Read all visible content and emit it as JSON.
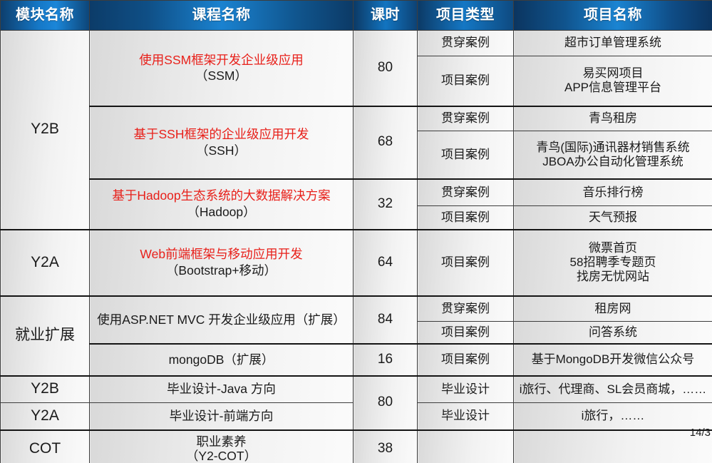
{
  "header": {
    "columns": [
      {
        "label": "模块名称",
        "key": "module"
      },
      {
        "label": "课程名称",
        "key": "course"
      },
      {
        "label": "课时",
        "key": "hours"
      },
      {
        "label": "项目类型",
        "key": "ptype"
      },
      {
        "label": "项目名称",
        "key": "pname"
      }
    ]
  },
  "colors": {
    "header_blue_dark": "#0c3a66",
    "header_blue_light": "#1a84d2",
    "course_red": "#e8201a",
    "cell_gray": "#d9d9d9",
    "cell_white": "#fbfbfb",
    "border": "#1a1a1a"
  },
  "rows": {
    "modules": {
      "y2b_1": "Y2B",
      "y2a_1": "Y2A",
      "employ": "就业扩展",
      "y2b_2": "Y2B",
      "y2a_2": "Y2A",
      "cot": "COT"
    },
    "courses": {
      "ssm_title": "使用SSM框架开发企业级应用",
      "ssm_sub": "（SSM）",
      "ssh_title": "基于SSH框架的企业级应用开发",
      "ssh_sub": "（SSH）",
      "hadoop_title": "基于Hadoop生态系统的大数据解决方案",
      "hadoop_sub": "（Hadoop）",
      "web_title": "Web前端框架与移动应用开发",
      "web_sub": "（Bootstrap+移动）",
      "aspnet": "使用ASP.NET MVC 开发企业级应用（扩展）",
      "mongodb": "mongoDB（扩展）",
      "grad_java": "毕业设计-Java 方向",
      "grad_front": "毕业设计-前端方向",
      "cot_title": "职业素养",
      "cot_sub": "（Y2-COT）"
    },
    "hours": {
      "ssm": "80",
      "ssh": "68",
      "hadoop": "32",
      "web": "64",
      "aspnet": "84",
      "mongodb": "16",
      "grad": "80",
      "cot": "38"
    },
    "ptypes": {
      "through_case": "贯穿案例",
      "project_case": "项目案例",
      "grad_design": "毕业设计",
      "empty": ""
    },
    "pnames": {
      "ssm_through": "超市订单管理系统",
      "ssm_project_l1": "易买网项目",
      "ssm_project_l2": "APP信息管理平台",
      "ssh_through": "青鸟租房",
      "ssh_project_l1": "青鸟(国际)通讯器材销售系统",
      "ssh_project_l2": "JBOA办公自动化管理系统",
      "hadoop_through": "音乐排行榜",
      "hadoop_project": "天气预报",
      "web_project_l1": "微票首页",
      "web_project_l2": "58招聘季专题页",
      "web_project_l3": "找房无忧网站",
      "aspnet_through": "租房网",
      "aspnet_project": "问答系统",
      "mongodb_project": "基于MongoDB开发微信公众号",
      "grad_java": "i旅行、代理商、SL会员商城，……",
      "grad_front": "i旅行，……",
      "empty": ""
    }
  },
  "footer": {
    "page_number": "14/3"
  }
}
